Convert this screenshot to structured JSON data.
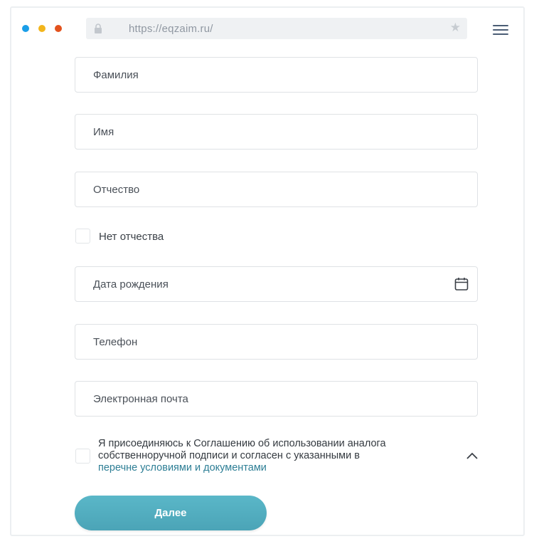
{
  "browser": {
    "window_controls": [
      {
        "name": "close",
        "color": "#1a9ee8"
      },
      {
        "name": "minimize",
        "color": "#f2b51c"
      },
      {
        "name": "maximize",
        "color": "#e3521d"
      }
    ],
    "url": "https://eqzaim.ru/",
    "lock_icon": "lock-icon",
    "bookmark_icon": "star-icon",
    "menu_icon": "hamburger-menu-icon"
  },
  "form": {
    "last_name": {
      "placeholder": "Фамилия",
      "value": ""
    },
    "first_name": {
      "placeholder": "Имя",
      "value": ""
    },
    "middle_name": {
      "placeholder": "Отчество",
      "value": ""
    },
    "no_middle_name_label": "Нет отчества",
    "birth_date": {
      "placeholder": "Дата рождения",
      "value": "",
      "icon": "calendar-icon"
    },
    "phone": {
      "placeholder": "Телефон",
      "value": ""
    },
    "email": {
      "placeholder": "Электронная почта",
      "value": ""
    },
    "agreement": {
      "text_line1": "Я присоединяюсь к Соглашению об использовании аналога",
      "text_line2": "собственноручной подписи и согласен с указанными в",
      "link_text": "перечне условиями и документами",
      "toggle_icon": "chevron-up-icon"
    },
    "submit_label": "Далее"
  },
  "colors": {
    "accent": "#4fa9bb",
    "link": "#2d7e95"
  }
}
